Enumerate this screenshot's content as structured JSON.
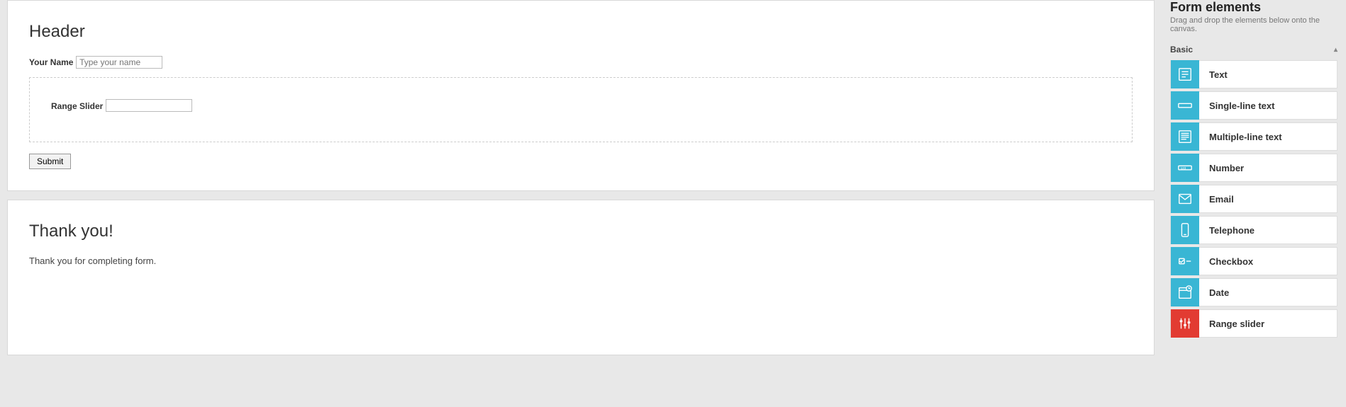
{
  "form": {
    "header": "Header",
    "name_label": "Your Name",
    "name_placeholder": "Type your name",
    "range_label": "Range Slider",
    "submit": "Submit"
  },
  "thank": {
    "header": "Thank you!",
    "body": "Thank you for completing form."
  },
  "sidebar": {
    "title": "Form elements",
    "desc": "Drag and drop the elements below onto the canvas.",
    "section": "Basic",
    "items": [
      {
        "label": "Text",
        "icon": "text",
        "color": "blue"
      },
      {
        "label": "Single-line text",
        "icon": "single",
        "color": "blue"
      },
      {
        "label": "Multiple-line text",
        "icon": "multi",
        "color": "blue"
      },
      {
        "label": "Number",
        "icon": "number",
        "color": "blue"
      },
      {
        "label": "Email",
        "icon": "email",
        "color": "blue"
      },
      {
        "label": "Telephone",
        "icon": "phone",
        "color": "blue"
      },
      {
        "label": "Checkbox",
        "icon": "check",
        "color": "blue"
      },
      {
        "label": "Date",
        "icon": "date",
        "color": "blue"
      },
      {
        "label": "Range slider",
        "icon": "range",
        "color": "red"
      }
    ]
  }
}
